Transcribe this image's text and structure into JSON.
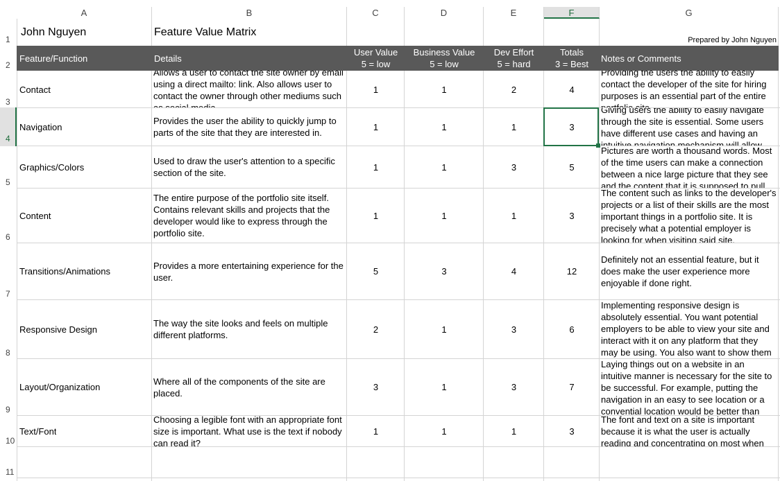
{
  "columns": [
    "A",
    "B",
    "C",
    "D",
    "E",
    "F",
    "G"
  ],
  "selected_column": "F",
  "row_numbers": [
    "1",
    "2",
    "3",
    "4",
    "5",
    "6",
    "7",
    "8",
    "9",
    "10",
    "11"
  ],
  "title_row": {
    "a1": "John Nguyen",
    "b1": "Feature Value Matrix",
    "g1": "Prepared by John Nguyen"
  },
  "header": {
    "feature": "Feature/Function",
    "details": "Details",
    "user_value": [
      "User Value",
      "5 = low"
    ],
    "business_value": [
      "Business Value",
      "5 = low"
    ],
    "dev_effort": [
      "Dev Effort",
      "5 = hard"
    ],
    "totals": [
      "Totals",
      "3 = Best"
    ],
    "notes": "Notes or Comments"
  },
  "rows": [
    {
      "feature": "Contact",
      "details": "Allows a user to contact the site owner by email using a direct mailto: link. Also allows user to contact the owner through other mediums such as social media.",
      "user": "1",
      "business": "1",
      "dev": "2",
      "total": "4",
      "notes": "Providing the users the ability to easily contact the developer of the site for hiring purposes is an essential part of the entire portfolio site."
    },
    {
      "feature": "Navigation",
      "details": "Provides the user the ability to quickly jump to parts of the site that they are interested in.",
      "user": "1",
      "business": "1",
      "dev": "1",
      "total": "3",
      "notes": "Giving users the ability to easily navigate through the site is essential. Some users have different use cases and having an intuitive navigation mechanism will allow them"
    },
    {
      "feature": "Graphics/Colors",
      "details": "Used to draw the user's attention to a specific section of the site.",
      "user": "1",
      "business": "1",
      "dev": "3",
      "total": "5",
      "notes": "Pictures are worth a thousand words. Most of the time users can make a connection between a nice large picture that they see and the content that it is supposed to pull"
    },
    {
      "feature": "Content",
      "details": "The entire purpose of the portfolio site itself. Contains relevant skills and projects that the developer would like to express through the portfolio site.",
      "user": "1",
      "business": "1",
      "dev": "1",
      "total": "3",
      "notes": "The content such as links to the developer's projects or a list of their skills are the most important things in a portfolio site. It is precisely what a potential employer is looking for when visiting said site."
    },
    {
      "feature": "Transitions/Animations",
      "details": "Provides a more entertaining experience for the user.",
      "user": "5",
      "business": "3",
      "dev": "4",
      "total": "12",
      "notes": "Definitely not an essential feature, but it does make the user experience more enjoyable if done right."
    },
    {
      "feature": "Responsive Design",
      "details": "The way the site looks and feels on multiple different platforms.",
      "user": "2",
      "business": "1",
      "dev": "3",
      "total": "6",
      "notes": "Implementing responsive design is absolutely essential. You want potential employers to be able to view your site and interact with it on any platform that they may be using. You also want to show them"
    },
    {
      "feature": "Layout/Organization",
      "details": "Where all of the components of the site are placed.",
      "user": "3",
      "business": "1",
      "dev": "3",
      "total": "7",
      "notes": "Laying things out on a website in an intuitive manner is necessary for the site to be successful. For example, putting the navigation in an easy to see location or a convential location would be better than"
    },
    {
      "feature": "Text/Font",
      "details": "Choosing a legible font with an appropriate font size is important. What use is the text if nobody can read it?",
      "user": "1",
      "business": "1",
      "dev": "1",
      "total": "3",
      "notes": "The font and text on a site is important because it is what the user is actually reading and concentrating on most when"
    }
  ]
}
